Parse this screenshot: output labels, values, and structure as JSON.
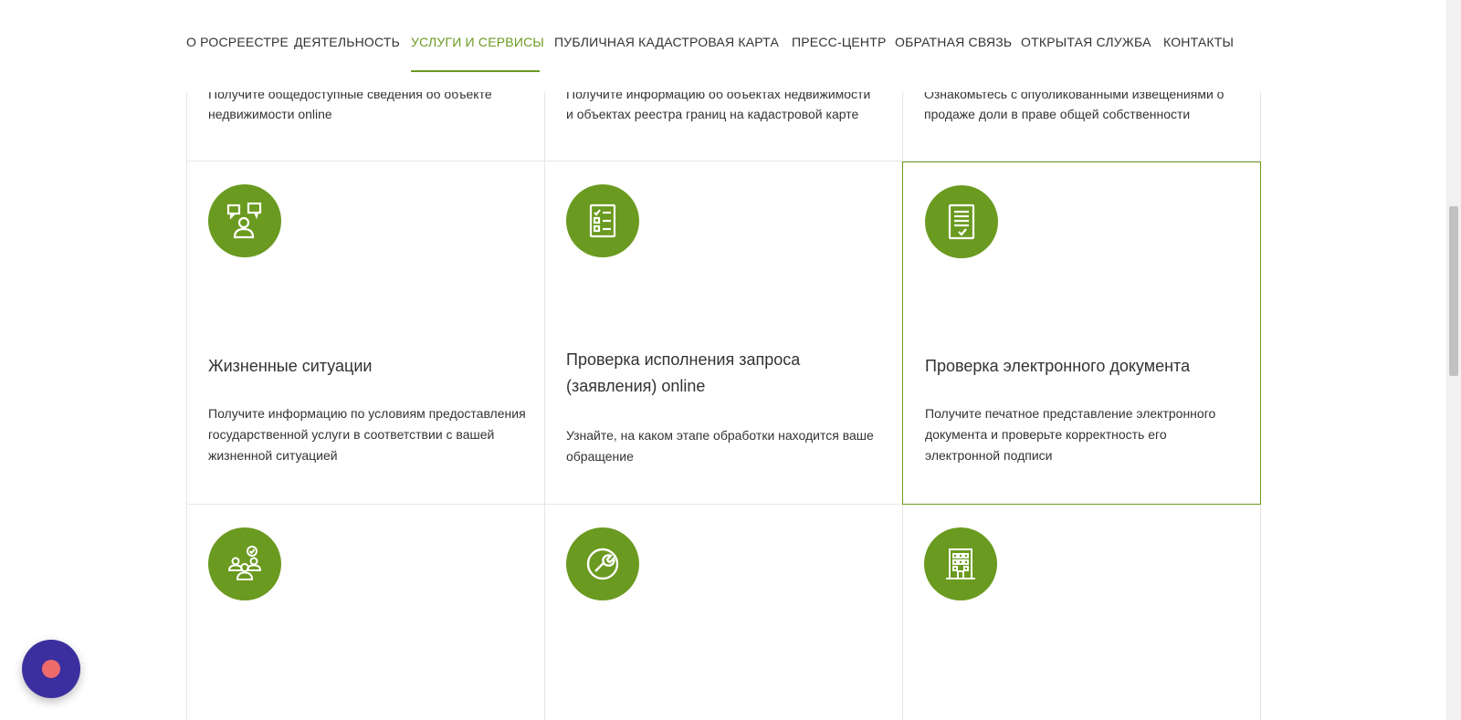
{
  "nav": {
    "items": [
      {
        "label": "О РОСРЕЕСТРЕ"
      },
      {
        "label": "ДЕЯТЕЛЬНОСТЬ"
      },
      {
        "label": "УСЛУГИ И СЕРВИСЫ",
        "active": true
      },
      {
        "label": "ПУБЛИЧНАЯ КАДАСТРОВАЯ КАРТА"
      },
      {
        "label": "ПРЕСС-ЦЕНТР"
      },
      {
        "label": "ОБРАТНАЯ СВЯЗЬ"
      },
      {
        "label": "ОТКРЫТАЯ СЛУЖБА"
      },
      {
        "label": "КОНТАКТЫ"
      }
    ]
  },
  "row_top": [
    {
      "desc_line1": "Получите общедоступные сведения об объекте",
      "desc_line2": "недвижимости online"
    },
    {
      "desc_line1": "Получите информацию об объектах недвижимости",
      "desc_line2": "и объектах реестра границ на кадастровой карте"
    },
    {
      "desc_line1": "Ознакомьтесь с опубликованными извещениями о",
      "desc_line2": "продаже доли в праве общей собственности"
    }
  ],
  "row_middle": [
    {
      "icon": "life-situations-icon",
      "title": "Жизненные ситуации",
      "desc": "Получите информацию по условиям предоставления государственной услуги в соответствии с вашей жизненной ситуацией"
    },
    {
      "icon": "checklist-icon",
      "title": "Проверка исполнения запроса (заявления) online",
      "desc": "Узнайте, на каком этапе обработки находится ваше обращение"
    },
    {
      "icon": "document-check-icon",
      "title": "Проверка электронного документа",
      "desc": "Получите печатное представление электронного документа и проверьте корректность его электронной подписи"
    }
  ],
  "row_bottom": [
    {
      "icon": "people-group-icon"
    },
    {
      "icon": "wrench-icon"
    },
    {
      "icon": "building-icon"
    }
  ],
  "colors": {
    "accent": "#6a9a1f",
    "chat": "#3b2fa0",
    "chat_dot": "#ee6b6b"
  }
}
